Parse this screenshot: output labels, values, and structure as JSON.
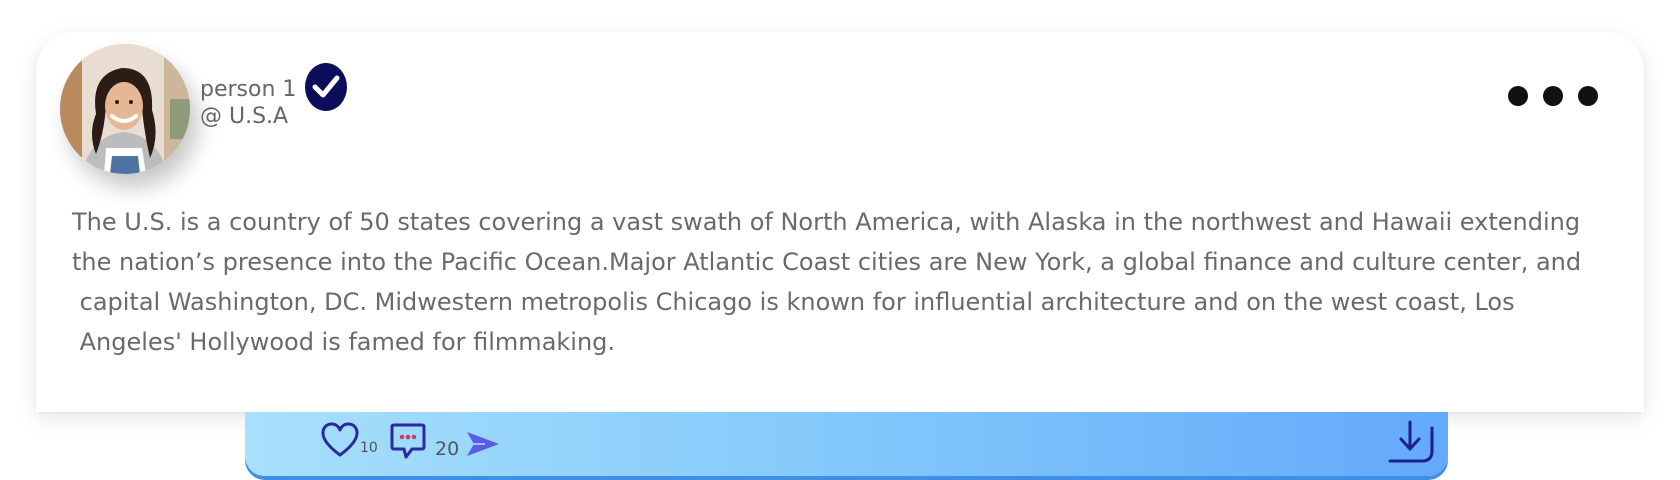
{
  "profile": {
    "username": "person 1",
    "handle": "@ U.S.A",
    "verified": true,
    "verified_color": "#0c0e5c"
  },
  "post": {
    "lines": [
      "The U.S. is a country of 50 states covering a vast swath of North America, with Alaska in the northwest and Hawaii extending",
      "the nation’s presence into the Pacific Ocean.Major Atlantic Coast cities are New York, a global finance and culture center, and",
      " capital Washington, DC. Midwestern metropolis Chicago is known for influential architecture and on the west coast, Los",
      " Angeles' Hollywood is famed for filmmaking."
    ]
  },
  "actions": {
    "like_count": "10",
    "comment_count": "20",
    "icons": [
      "heart-icon",
      "comment-icon",
      "send-icon",
      "download-icon",
      "more-icon"
    ]
  },
  "colors": {
    "accent_dark": "#2a2a9a",
    "send": "#5a5ae6",
    "bar_start": "#a8e0fc",
    "bar_end": "#64a9fa"
  }
}
